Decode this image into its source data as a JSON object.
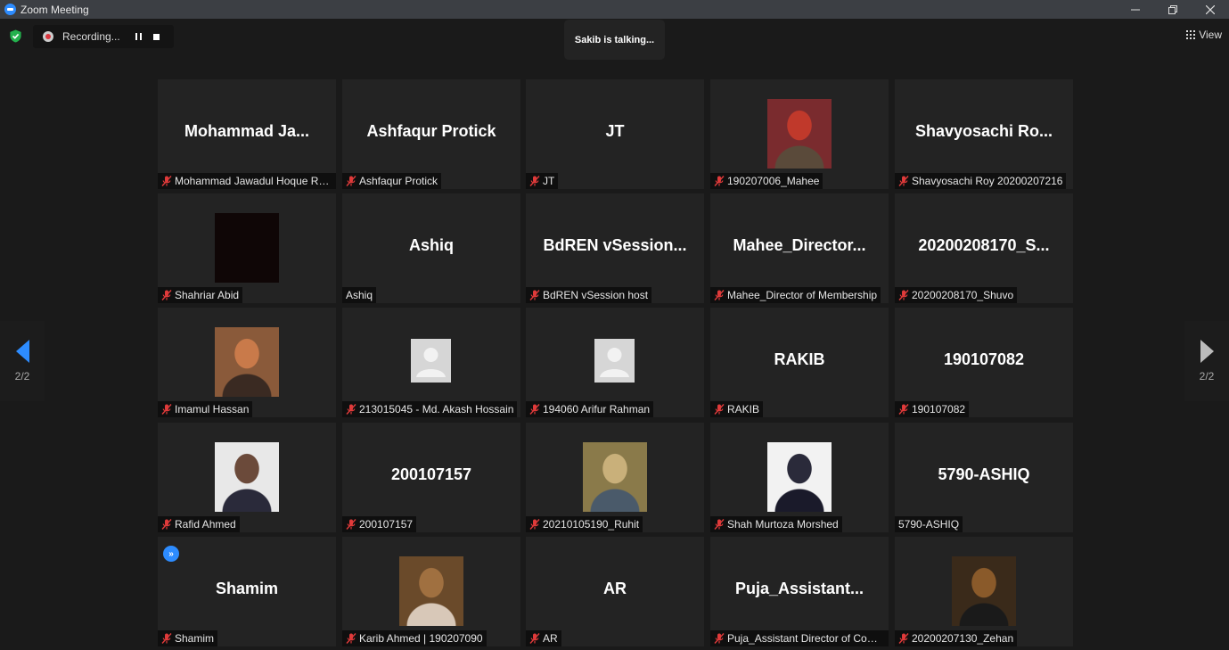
{
  "window": {
    "title": "Zoom Meeting"
  },
  "recording": {
    "label": "Recording..."
  },
  "talking": "Sakib is talking...",
  "view_label": "View",
  "pagination": {
    "left": "2/2",
    "right": "2/2"
  },
  "tiles": [
    {
      "display": "Mohammad Ja...",
      "label": "Mohammad Jawadul Hoque Rohan",
      "muted": true,
      "video": null
    },
    {
      "display": "Ashfaqur Protick",
      "label": "Ashfaqur Protick",
      "muted": true,
      "video": null
    },
    {
      "display": "JT",
      "label": "JT",
      "muted": true,
      "video": null
    },
    {
      "display": "",
      "label": "190207006_Mahee",
      "muted": true,
      "video": "photo"
    },
    {
      "display": "Shavyosachi Ro...",
      "label": "Shavyosachi Roy 20200207216",
      "muted": true,
      "video": null
    },
    {
      "display": "",
      "label": "Shahriar Abid",
      "muted": true,
      "video": "dark"
    },
    {
      "display": "Ashiq",
      "label": "Ashiq",
      "muted": false,
      "video": null
    },
    {
      "display": "BdREN vSession...",
      "label": "BdREN vSession host",
      "muted": true,
      "video": null
    },
    {
      "display": "Mahee_Director...",
      "label": "Mahee_Director of Membership",
      "muted": true,
      "video": null
    },
    {
      "display": "20200208170_S...",
      "label": "20200208170_Shuvo",
      "muted": true,
      "video": null
    },
    {
      "display": "",
      "label": "Imamul Hassan",
      "muted": true,
      "video": "photo"
    },
    {
      "display": "",
      "label": "213015045 - Md. Akash Hossain",
      "muted": true,
      "video": "avatar"
    },
    {
      "display": "",
      "label": "194060 Arifur Rahman",
      "muted": true,
      "video": "avatar"
    },
    {
      "display": "RAKIB",
      "label": "RAKIB",
      "muted": true,
      "video": null
    },
    {
      "display": "190107082",
      "label": "190107082",
      "muted": true,
      "video": null
    },
    {
      "display": "",
      "label": "Rafid Ahmed",
      "muted": true,
      "video": "photo"
    },
    {
      "display": "200107157",
      "label": "200107157",
      "muted": true,
      "video": null
    },
    {
      "display": "",
      "label": "20210105190_Ruhit",
      "muted": true,
      "video": "photo"
    },
    {
      "display": "",
      "label": "Shah Murtoza Morshed",
      "muted": true,
      "video": "photo"
    },
    {
      "display": "5790-ASHIQ",
      "label": "5790-ASHIQ",
      "muted": false,
      "video": null
    },
    {
      "display": "Shamim",
      "label": "Shamim",
      "muted": true,
      "video": null
    },
    {
      "display": "",
      "label": "Karib Ahmed | 190207090",
      "muted": true,
      "video": "photo"
    },
    {
      "display": "AR",
      "label": "AR",
      "muted": true,
      "video": null
    },
    {
      "display": "Puja_Assistant...",
      "label": "Puja_Assistant Director of Commu...",
      "muted": true,
      "video": null
    },
    {
      "display": "",
      "label": "20200207130_Zehan",
      "muted": true,
      "video": "photo"
    }
  ]
}
